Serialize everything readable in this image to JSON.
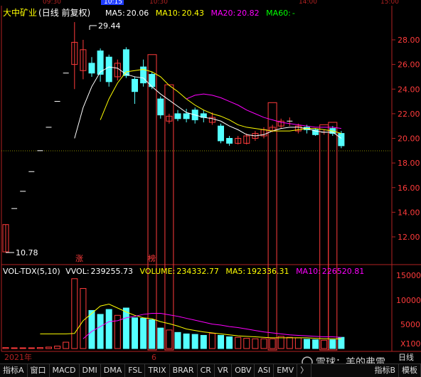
{
  "stock": {
    "name": "大中矿业",
    "mode": "(日线 前复权)"
  },
  "ma": [
    {
      "label": "MA5:",
      "value": "20.06",
      "color": "#ffffff"
    },
    {
      "label": "MA10:",
      "value": "20.43",
      "color": "#ffff00"
    },
    {
      "label": "MA20:",
      "value": "20.82",
      "color": "#ff00ff"
    },
    {
      "label": "MA60:",
      "value": "-",
      "color": "#00ff00"
    }
  ],
  "time_labels": [
    "09:30",
    "10:15",
    "10:30",
    "14:00",
    "15:00"
  ],
  "price_axis": {
    "min": 10,
    "max": 29,
    "ticks": [
      "28.00",
      "26.00",
      "24.00",
      "22.00",
      "20.00",
      "18.00",
      "16.00",
      "14.00",
      "12.00"
    ]
  },
  "high_mark": "29.44",
  "low_mark": "10.78",
  "zhang": "涨",
  "bang": "榜",
  "vol": {
    "title": "VOL-TDX(5,10)",
    "vvol_label": "VVOL:",
    "vvol": "239255.73",
    "volume_label": "VOLUME:",
    "volume": "234332.77",
    "ma5_label": "MA5:",
    "ma5": "192336.31",
    "ma10_label": "MA10:",
    "ma10": "226520.81",
    "axis": [
      "15000",
      "10000",
      "5000",
      "X100"
    ]
  },
  "year_label": "2021年",
  "date_marker": "6",
  "watermark": "雪球：羔的弗雷",
  "corner_label": "日线",
  "colors": {
    "up": "#ff3b3b",
    "down": "#54ffff",
    "ma5": "#ffffff",
    "ma10": "#ffff00",
    "ma20": "#ff00ff",
    "axis": "#b22222"
  },
  "tabs": [
    "指标A",
    "窗口",
    "MACD",
    "DMI",
    "DMA",
    "FSL",
    "TRIX",
    "BRAR",
    "CR",
    "VR",
    "OBV",
    "ASI",
    "EMV",
    "〉",
    "指标B",
    "模板"
  ],
  "chart_data": {
    "type": "candlestick",
    "y_range": [
      10,
      29.5
    ],
    "vol_range": [
      0,
      17000
    ],
    "candles": [
      {
        "o": 10.78,
        "c": 13.0,
        "h": 13.0,
        "l": 10.78,
        "v": 200
      },
      {
        "o": 14.3,
        "c": 14.3,
        "h": 14.3,
        "l": 14.3,
        "v": 150
      },
      {
        "o": 15.7,
        "c": 15.7,
        "h": 15.7,
        "l": 15.7,
        "v": 150
      },
      {
        "o": 17.3,
        "c": 17.3,
        "h": 17.3,
        "l": 17.3,
        "v": 150
      },
      {
        "o": 19.0,
        "c": 19.0,
        "h": 19.0,
        "l": 19.0,
        "v": 200
      },
      {
        "o": 20.9,
        "c": 20.9,
        "h": 20.9,
        "l": 20.9,
        "v": 300
      },
      {
        "o": 23.0,
        "c": 23.0,
        "h": 23.0,
        "l": 23.0,
        "v": 500
      },
      {
        "o": 25.3,
        "c": 25.3,
        "h": 25.3,
        "l": 25.3,
        "v": 1300
      },
      {
        "o": 26.0,
        "c": 27.8,
        "h": 29.44,
        "l": 24.0,
        "v": 14300
      },
      {
        "o": 25.5,
        "c": 27.2,
        "h": 28.0,
        "l": 24.8,
        "v": 12300
      },
      {
        "o": 26.1,
        "c": 25.3,
        "h": 26.6,
        "l": 25.0,
        "v": 7800
      },
      {
        "o": 27.1,
        "c": 25.2,
        "h": 27.3,
        "l": 24.6,
        "v": 7000
      },
      {
        "o": 26.6,
        "c": 24.6,
        "h": 26.8,
        "l": 24.2,
        "v": 8000
      },
      {
        "o": 25.0,
        "c": 26.1,
        "h": 26.4,
        "l": 24.7,
        "v": 6800
      },
      {
        "o": 27.2,
        "c": 25.1,
        "h": 27.4,
        "l": 24.9,
        "v": 8300
      },
      {
        "o": 24.8,
        "c": 23.8,
        "h": 25.0,
        "l": 22.8,
        "v": 6300
      },
      {
        "o": 25.8,
        "c": 24.5,
        "h": 26.4,
        "l": 24.2,
        "v": 6200
      },
      {
        "o": 25.2,
        "c": 24.2,
        "h": 25.4,
        "l": 24.0,
        "v": 5900
      },
      {
        "o": 23.2,
        "c": 21.9,
        "h": 23.4,
        "l": 21.6,
        "v": 4200
      },
      {
        "o": 21.4,
        "c": 21.8,
        "h": 22.0,
        "l": 21.2,
        "v": 3800
      },
      {
        "o": 22.0,
        "c": 21.6,
        "h": 22.3,
        "l": 21.4,
        "v": 3300
      },
      {
        "o": 22.0,
        "c": 21.6,
        "h": 22.4,
        "l": 21.3,
        "v": 3000
      },
      {
        "o": 22.3,
        "c": 21.5,
        "h": 22.5,
        "l": 21.2,
        "v": 2900
      },
      {
        "o": 22.0,
        "c": 21.7,
        "h": 22.3,
        "l": 21.3,
        "v": 2700
      },
      {
        "o": 21.3,
        "c": 21.7,
        "h": 22.1,
        "l": 21.1,
        "v": 3100
      },
      {
        "o": 21.0,
        "c": 19.8,
        "h": 21.2,
        "l": 19.6,
        "v": 2700
      },
      {
        "o": 20.0,
        "c": 19.6,
        "h": 20.2,
        "l": 19.4,
        "v": 2400
      },
      {
        "o": 19.6,
        "c": 20.0,
        "h": 20.2,
        "l": 19.5,
        "v": 2300
      },
      {
        "o": 19.6,
        "c": 20.2,
        "h": 20.4,
        "l": 19.5,
        "v": 2100
      },
      {
        "o": 20.0,
        "c": 20.4,
        "h": 20.6,
        "l": 19.8,
        "v": 2000
      },
      {
        "o": 20.2,
        "c": 20.7,
        "h": 20.9,
        "l": 20.0,
        "v": 2000
      },
      {
        "o": 20.6,
        "c": 20.9,
        "h": 21.1,
        "l": 20.5,
        "v": 2000
      },
      {
        "o": 21.0,
        "c": 21.4,
        "h": 21.6,
        "l": 20.8,
        "v": 2500
      },
      {
        "o": 21.4,
        "c": 21.4,
        "h": 21.7,
        "l": 21.0,
        "v": 2300
      },
      {
        "o": 20.6,
        "c": 21.0,
        "h": 21.2,
        "l": 20.4,
        "v": 2200
      },
      {
        "o": 20.9,
        "c": 20.7,
        "h": 21.1,
        "l": 20.4,
        "v": 1900
      },
      {
        "o": 20.7,
        "c": 20.3,
        "h": 20.8,
        "l": 20.2,
        "v": 1800
      },
      {
        "o": 20.5,
        "c": 20.5,
        "h": 20.7,
        "l": 20.3,
        "v": 1700
      },
      {
        "o": 20.8,
        "c": 20.4,
        "h": 21.0,
        "l": 20.2,
        "v": 1800
      },
      {
        "o": 20.4,
        "c": 19.4,
        "h": 20.6,
        "l": 19.2,
        "v": 2300
      }
    ],
    "ma5": [
      null,
      null,
      null,
      null,
      null,
      null,
      null,
      null,
      20.0,
      22.5,
      24.2,
      25.4,
      25.8,
      25.7,
      25.2,
      25.0,
      24.9,
      24.2,
      23.6,
      23.1,
      22.6,
      22.1,
      21.9,
      21.7,
      21.6,
      21.4,
      21.0,
      20.7,
      20.3,
      20.2,
      20.3,
      20.6,
      20.8,
      20.9,
      20.9,
      20.8,
      20.6,
      20.5,
      20.5,
      20.0
    ],
    "ma10": [
      null,
      null,
      null,
      null,
      null,
      null,
      null,
      null,
      null,
      null,
      null,
      21.5,
      23.2,
      24.5,
      25.4,
      25.5,
      25.6,
      25.4,
      25.0,
      24.3,
      23.8,
      23.2,
      22.7,
      22.3,
      22.0,
      21.8,
      21.5,
      21.1,
      20.9,
      20.8,
      20.7,
      20.6,
      20.6,
      20.6,
      20.7,
      20.8,
      20.8,
      20.7,
      20.6,
      20.4
    ],
    "ma20": [
      null,
      null,
      null,
      null,
      null,
      null,
      null,
      null,
      null,
      null,
      null,
      null,
      null,
      null,
      null,
      null,
      null,
      null,
      null,
      null,
      null,
      23.2,
      23.5,
      23.6,
      23.5,
      23.3,
      23.0,
      22.7,
      22.3,
      22.0,
      21.7,
      21.5,
      21.3,
      21.2,
      21.1,
      21.0,
      20.9,
      20.9,
      20.9,
      20.8
    ],
    "vol_ma5": [
      null,
      null,
      null,
      null,
      3000,
      3000,
      3000,
      3000,
      3100,
      5700,
      7200,
      8700,
      9100,
      8300,
      7500,
      6800,
      6300,
      6100,
      5500,
      5100,
      4600,
      4000,
      3700,
      3400,
      3200,
      3000,
      2800,
      2600,
      2500,
      2400,
      2300,
      2200,
      2200,
      2200,
      2200,
      2200,
      2100,
      2000,
      2000,
      2000
    ],
    "vol_ma10": [
      null,
      null,
      null,
      null,
      null,
      null,
      null,
      null,
      null,
      2000,
      3500,
      4500,
      5500,
      5700,
      6300,
      6600,
      7000,
      7200,
      7200,
      6900,
      6600,
      6200,
      5800,
      5400,
      5000,
      4800,
      4500,
      4300,
      4000,
      3700,
      3400,
      3200,
      3000,
      2800,
      2700,
      2600,
      2500,
      2400,
      2400,
      2300
    ],
    "boxes": [
      [
        19,
        24.35,
        11
      ],
      [
        31,
        22.9,
        11
      ],
      [
        37,
        21.1,
        11
      ],
      [
        38,
        21.3,
        11
      ]
    ]
  }
}
